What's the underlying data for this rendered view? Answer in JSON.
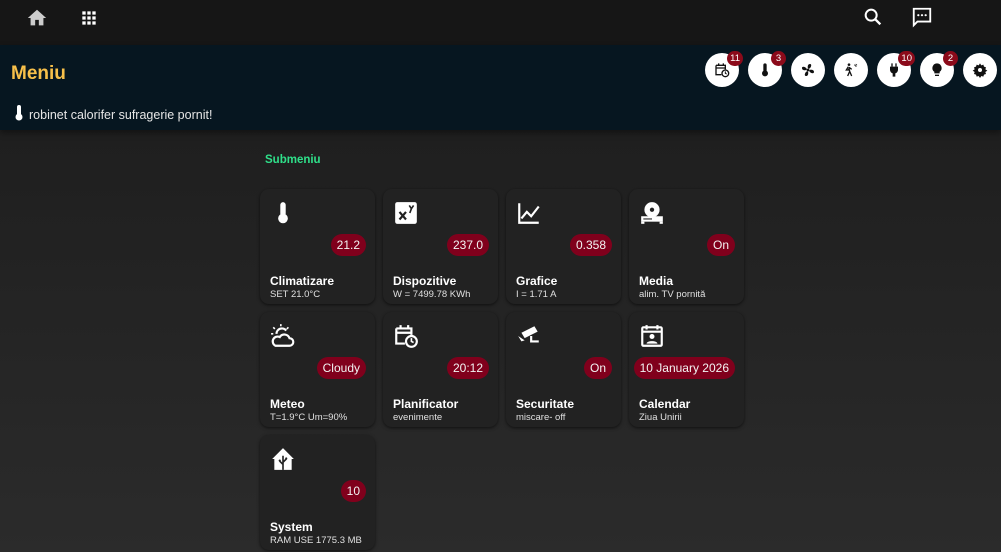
{
  "header": {
    "title": "Meniu",
    "notice": "robinet calorifer sufragerie pornit!"
  },
  "header_buttons": [
    {
      "icon": "calendar-clock-icon",
      "badge": "11"
    },
    {
      "icon": "thermometer-icon",
      "badge": "3"
    },
    {
      "icon": "fan-icon",
      "badge": ""
    },
    {
      "icon": "motion-sensor-icon",
      "badge": ""
    },
    {
      "icon": "power-plug-icon",
      "badge": "10"
    },
    {
      "icon": "lightbulb-icon",
      "badge": "2"
    },
    {
      "icon": "gear-icon",
      "badge": ""
    }
  ],
  "submenu": "Submeniu",
  "cards": [
    {
      "name": "Climatizare",
      "sub": "SET 21.0°C",
      "badge": "21.2",
      "icon": "thermometer-icon"
    },
    {
      "name": "Dispozitive",
      "sub": "W = 7499.78 KWh",
      "badge": "237.0",
      "icon": "math-xy-icon"
    },
    {
      "name": "Grafice",
      "sub": "I = 1.71 A",
      "badge": "0.358",
      "icon": "chart-line-icon"
    },
    {
      "name": "Media",
      "sub": "alim. TV pornită",
      "badge": "On",
      "icon": "disc-player-icon"
    },
    {
      "name": "Meteo",
      "sub": "T=1.9°C Um=90%",
      "badge": "Cloudy",
      "icon": "weather-partly-cloudy-icon"
    },
    {
      "name": "Planificator",
      "sub": "evenimente",
      "badge": "20:12",
      "icon": "calendar-clock-icon"
    },
    {
      "name": "Securitate",
      "sub": "miscare- off",
      "badge": "On",
      "icon": "cctv-icon"
    },
    {
      "name": "Calendar",
      "sub": "Ziua Unirii",
      "badge": "10 January 2026",
      "icon": "calendar-account-icon"
    },
    {
      "name": "System",
      "sub": "RAM USE 1775.3 MB",
      "badge": "10",
      "icon": "home-assistant-icon"
    }
  ]
}
